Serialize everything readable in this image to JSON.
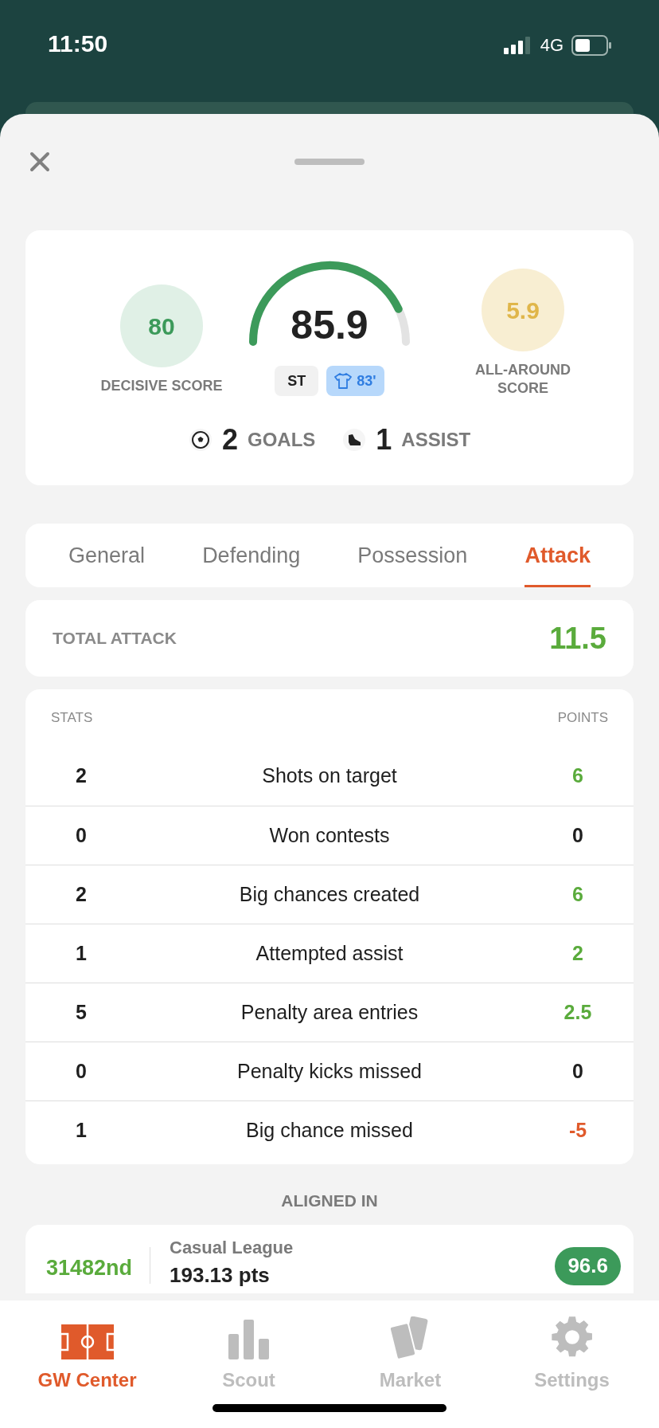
{
  "status_bar": {
    "time": "11:50",
    "network": "4G"
  },
  "player_card": {
    "decisive": {
      "value": "80",
      "label": "DECISIVE SCORE"
    },
    "score": {
      "value": "85.9"
    },
    "position": "ST",
    "minutes": "83'",
    "all_around": {
      "value": "5.9",
      "label": "ALL-AROUND SCORE"
    },
    "highlights": [
      {
        "kind": "goal",
        "count": "2",
        "label": "GOALS"
      },
      {
        "kind": "assist",
        "count": "1",
        "label": "ASSIST"
      }
    ]
  },
  "tabs": [
    {
      "label": "General",
      "selected": false
    },
    {
      "label": "Defending",
      "selected": false
    },
    {
      "label": "Possession",
      "selected": false
    },
    {
      "label": "Attack",
      "selected": true
    }
  ],
  "total": {
    "label": "TOTAL ATTACK",
    "value": "11.5"
  },
  "stats_table": {
    "columns": [
      "STATS",
      "POINTS"
    ],
    "rows": [
      {
        "count": "2",
        "name": "Shots on target",
        "points": "6",
        "color": "#5aab3c"
      },
      {
        "count": "0",
        "name": "Won contests",
        "points": "0",
        "color": "#1f1f1f"
      },
      {
        "count": "2",
        "name": "Big chances created",
        "points": "6",
        "color": "#5aab3c"
      },
      {
        "count": "1",
        "name": "Attempted assist",
        "points": "2",
        "color": "#5aab3c"
      },
      {
        "count": "5",
        "name": "Penalty area entries",
        "points": "2.5",
        "color": "#5aab3c"
      },
      {
        "count": "0",
        "name": "Penalty kicks missed",
        "points": "0",
        "color": "#1f1f1f"
      },
      {
        "count": "1",
        "name": "Big chance missed",
        "points": "-5",
        "color": "#e05a2b"
      }
    ]
  },
  "aligned_in": {
    "title": "ALIGNED IN",
    "leagues": [
      {
        "rank": "31482nd",
        "name": "Casual League",
        "points": "193.13 pts",
        "score": "96.6"
      }
    ]
  },
  "bottom_nav": [
    {
      "kind": "pitch",
      "label": "GW Center",
      "selected": true
    },
    {
      "kind": "bars",
      "label": "Scout",
      "selected": false
    },
    {
      "kind": "cards",
      "label": "Market",
      "selected": false
    },
    {
      "kind": "gear",
      "label": "Settings",
      "selected": false
    }
  ]
}
